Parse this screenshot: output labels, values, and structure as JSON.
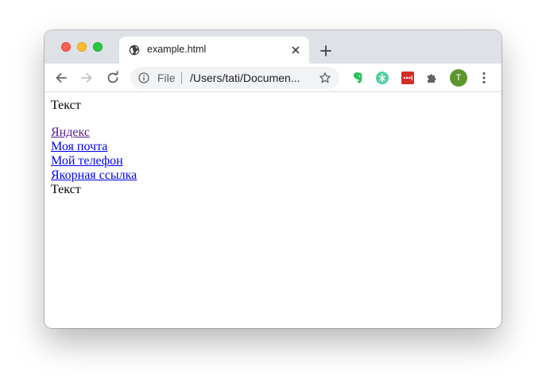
{
  "browser": {
    "tab": {
      "title": "example.html"
    },
    "address_bar": {
      "scheme_label": "File",
      "url": "/Users/tati/Documen..."
    },
    "profile_initial": "T",
    "colors": {
      "titlebar": "#dee1e6",
      "profile": "#5d9530",
      "visited_link": "#551a8b",
      "link": "#0000ee"
    }
  },
  "page": {
    "text_top": "Текст",
    "links": [
      {
        "label": "Яндекс",
        "visited": true
      },
      {
        "label": "Моя почта",
        "visited": false
      },
      {
        "label": "Мой телефон",
        "visited": false
      },
      {
        "label": "Якорная ссылка",
        "visited": false
      }
    ],
    "text_bottom": "Текст"
  }
}
